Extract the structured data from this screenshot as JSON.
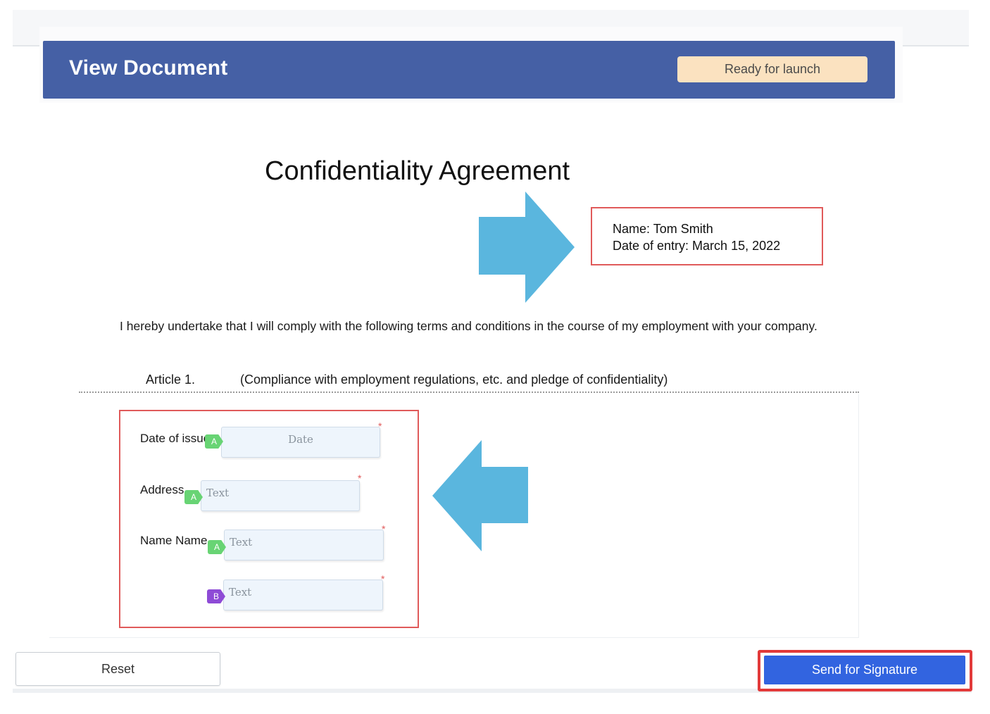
{
  "header": {
    "title": "View Document",
    "status": "Ready for launch"
  },
  "document": {
    "title": "Confidentiality Agreement",
    "info": {
      "name_line": "Name: Tom Smith",
      "date_line": "Date of entry: March 15, 2022"
    },
    "body": "I hereby undertake that I will comply with the following terms and conditions in the course of my employment with your company.",
    "article": {
      "number": "Article 1.",
      "title": "(Compliance with employment regulations, etc. and pledge of confidentiality)"
    }
  },
  "form_fields": [
    {
      "label": "Date of issue",
      "placeholder": "Date",
      "signer": "A",
      "required_mark": "*"
    },
    {
      "label": "Address",
      "placeholder": "Text",
      "signer": "A",
      "required_mark": "*"
    },
    {
      "label": "Name Name",
      "placeholder": "Text",
      "signer": "A",
      "required_mark": "*"
    },
    {
      "label": "",
      "placeholder": "Text",
      "signer": "B",
      "required_mark": "*"
    }
  ],
  "colors": {
    "header_bg": "#4560a5",
    "badge_bg": "#fbe2c0",
    "arrow": "#5ab6de",
    "highlight": "#e05a5a",
    "signer_a": "#68d474",
    "signer_b": "#8e4bd6",
    "primary_button": "#3264e0"
  },
  "icons": {
    "pointer_right": "arrow-right-icon",
    "pointer_left": "arrow-left-icon"
  },
  "footer": {
    "reset_label": "Reset",
    "send_label": "Send for Signature"
  }
}
